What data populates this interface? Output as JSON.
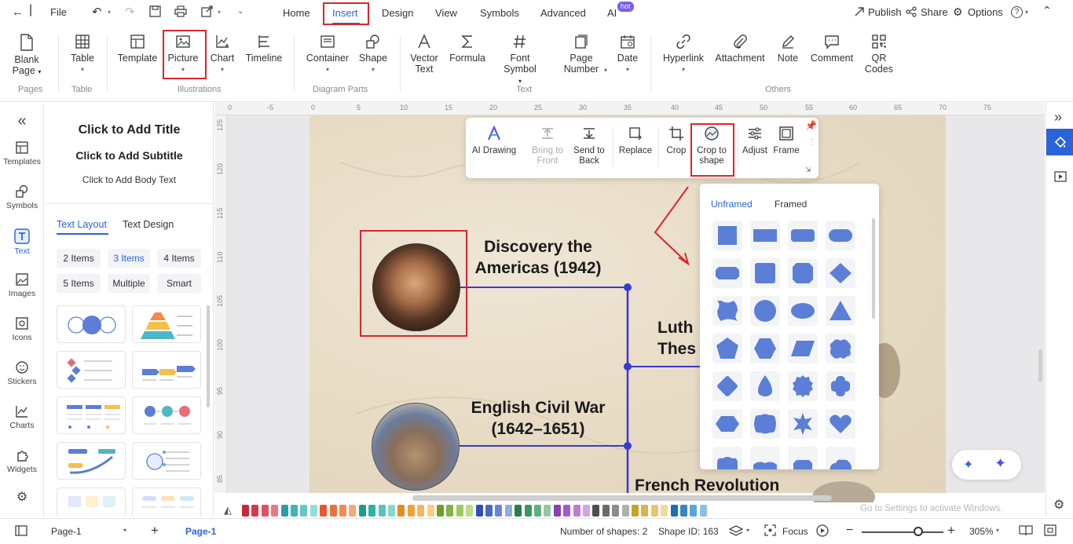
{
  "titlebar": {
    "file_label": "File",
    "menu_tabs": [
      "Home",
      "Insert",
      "Design",
      "View",
      "Symbols",
      "Advanced",
      "AI"
    ],
    "ai_badge": "hot",
    "publish_label": "Publish",
    "share_label": "Share",
    "options_label": "Options",
    "help_label": "?"
  },
  "ribbon": {
    "buttons": {
      "blank_page": [
        "Blank",
        "Page"
      ],
      "table": "Table",
      "template": "Template",
      "picture": "Picture",
      "chart": "Chart",
      "timeline": "Timeline",
      "container": "Container",
      "shape": "Shape",
      "vector_text": [
        "Vector",
        "Text"
      ],
      "formula": "Formula",
      "font_symbol": [
        "Font",
        "Symbol"
      ],
      "page_number": [
        "Page",
        "Number"
      ],
      "date": "Date",
      "hyperlink": "Hyperlink",
      "attachment": "Attachment",
      "note": "Note",
      "comment": "Comment",
      "qr_codes": [
        "QR",
        "Codes"
      ]
    },
    "groups": [
      "Pages",
      "Table",
      "Illustrations",
      "Diagram Parts",
      "Text",
      "Others"
    ]
  },
  "leftbar": {
    "items": [
      "Templates",
      "Symbols",
      "Text",
      "Images",
      "Icons",
      "Stickers",
      "Charts",
      "Widgets"
    ]
  },
  "leftpanel": {
    "title": "Click to Add Title",
    "subtitle": "Click to Add Subtitle",
    "body": "Click to Add Body Text",
    "tabs": [
      "Text Layout",
      "Text Design"
    ],
    "chips": [
      "2 Items",
      "3 Items",
      "4 Items",
      "5 Items",
      "Multiple",
      "Smart"
    ]
  },
  "ruler": {
    "top": [
      "0",
      "-5",
      "0",
      "5",
      "10",
      "15",
      "20",
      "25",
      "30",
      "35",
      "40",
      "45",
      "50",
      "55",
      "60",
      "65",
      "70",
      "75"
    ],
    "left": [
      "125",
      "120",
      "115",
      "110",
      "105",
      "100",
      "95",
      "90",
      "85"
    ]
  },
  "canvas": {
    "events": [
      {
        "title": [
          "Discovery the",
          "Americas (1942)"
        ]
      },
      {
        "title": [
          "Luth",
          "Thes"
        ]
      },
      {
        "title": [
          "English Civil War",
          "(1642–1651)"
        ]
      },
      {
        "title": [
          "French Revolution"
        ]
      }
    ]
  },
  "floatbar": {
    "buttons": [
      {
        "label": [
          "AI Drawing"
        ]
      },
      {
        "label": [
          "Bring to",
          "Front"
        ]
      },
      {
        "label": [
          "Send to",
          "Back"
        ]
      },
      {
        "label": [
          "Replace"
        ]
      },
      {
        "label": [
          "Crop"
        ]
      },
      {
        "label": [
          "Crop to",
          "shape"
        ]
      },
      {
        "label": [
          "Adjust"
        ]
      },
      {
        "label": [
          "Frame"
        ]
      }
    ]
  },
  "shapepanel": {
    "tabs": [
      "Unframed",
      "Framed"
    ],
    "shape_color": "#5b7fd6"
  },
  "statusbar": {
    "page_select": "Page-1",
    "page_tab": "Page-1",
    "shape_count": "Number of shapes: 2",
    "shape_id": "Shape ID: 163",
    "focus_label": "Focus",
    "zoom": "305%",
    "watermark": "Go to Settings to activate Windows."
  },
  "colors": {
    "accent": "#2b63d9",
    "highlight": "#d9262c"
  }
}
